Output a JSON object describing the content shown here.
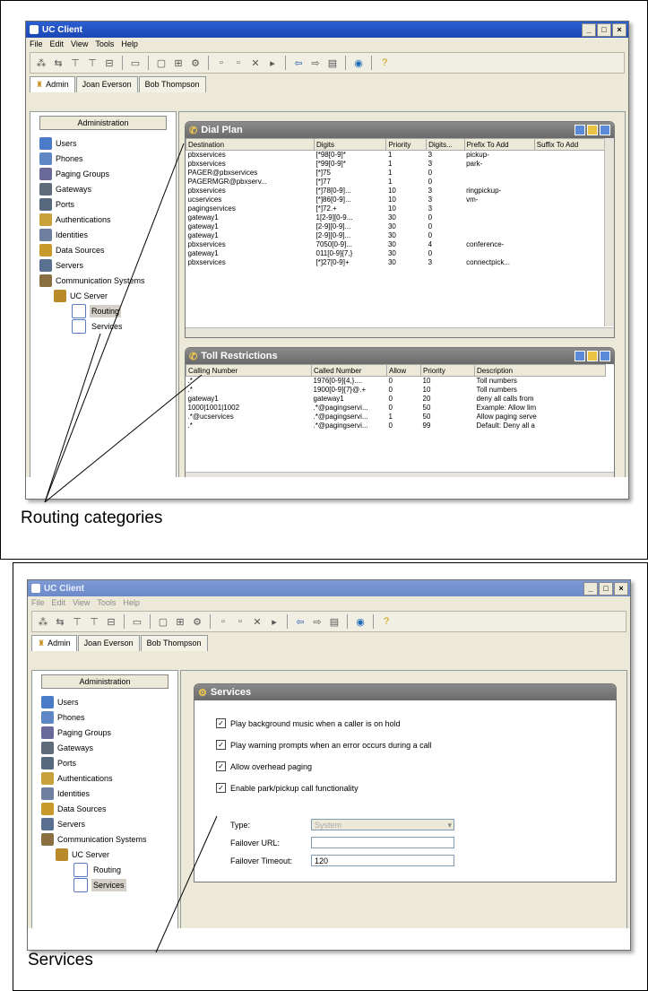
{
  "window": {
    "title": "UC Client",
    "controls": [
      "_",
      "□",
      "×"
    ],
    "menu": [
      "File",
      "Edit",
      "View",
      "Tools",
      "Help"
    ],
    "toolbar_icons": [
      "tool-1-icon",
      "tool-2-icon",
      "tool-3-icon",
      "tool-4-icon",
      "tool-5-icon",
      "tool-6-icon",
      "tool-7-icon",
      "tool-8-icon",
      "tool-9-icon",
      "tool-10-icon",
      "tool-11-icon",
      "tool-12-icon",
      "tool-13-icon",
      "back-arrow-icon",
      "forward-arrow-icon",
      "page-icon",
      "globe-icon",
      "help-icon"
    ],
    "tabs": [
      "Admin",
      "Joan Everson",
      "Bob Thompson"
    ]
  },
  "sidebar": {
    "header": "Administration",
    "items": [
      {
        "label": "Users",
        "icon": "users-icon",
        "color": "#4a7bc8"
      },
      {
        "label": "Phones",
        "icon": "phones-icon",
        "color": "#5d88c5"
      },
      {
        "label": "Paging Groups",
        "icon": "paging-groups-icon",
        "color": "#6a6a9a"
      },
      {
        "label": "Gateways",
        "icon": "gateways-icon",
        "color": "#5e6b7a"
      },
      {
        "label": "Ports",
        "icon": "ports-icon",
        "color": "#56697f"
      },
      {
        "label": "Authentications",
        "icon": "authentications-icon",
        "color": "#c8a13a"
      },
      {
        "label": "Identities",
        "icon": "identities-icon",
        "color": "#6f7fa0"
      },
      {
        "label": "Data Sources",
        "icon": "data-sources-icon",
        "color": "#c89a2c"
      },
      {
        "label": "Servers",
        "icon": "servers-icon",
        "color": "#5a7090"
      },
      {
        "label": "Communication Systems",
        "icon": "communication-systems-icon",
        "color": "#8a7040"
      }
    ],
    "server": "UC Server",
    "children": [
      "Routing",
      "Services"
    ]
  },
  "dial_plan": {
    "title": "Dial Plan",
    "columns": [
      "Destination",
      "Digits",
      "Priority",
      "Digits...",
      "Prefix To Add",
      "Suffix To Add"
    ],
    "rows": [
      [
        "pbxservices",
        "[*98[0-9]*",
        "1",
        "3",
        "pickup-",
        ""
      ],
      [
        "pbxservices",
        "[*99[0-9]*",
        "1",
        "3",
        "park-",
        ""
      ],
      [
        "PAGER@pbxservices",
        "[*]75",
        "1",
        "0",
        "",
        ""
      ],
      [
        "PAGERMGR@pbxserv...",
        "[*]77",
        "1",
        "0",
        "",
        ""
      ],
      [
        "pbxservices",
        "[*]78[0-9]...",
        "10",
        "3",
        "ringpickup-",
        ""
      ],
      [
        "ucservices",
        "[*]86[0-9]...",
        "10",
        "3",
        "vm-",
        ""
      ],
      [
        "pagingservices",
        "[*]72.+",
        "10",
        "3",
        "",
        ""
      ],
      [
        "gateway1",
        "1[2-9][0-9...",
        "30",
        "0",
        "",
        ""
      ],
      [
        "gateway1",
        "[2-9][0-9]...",
        "30",
        "0",
        "",
        ""
      ],
      [
        "gateway1",
        "[2-9][0-9]...",
        "30",
        "0",
        "",
        ""
      ],
      [
        "pbxservices",
        "7050[0-9]...",
        "30",
        "4",
        "conference-",
        ""
      ],
      [
        "gateway1",
        "011[0-9]{7,}",
        "30",
        "0",
        "",
        ""
      ],
      [
        "pbxservices",
        "[*]27[0-9]+",
        "30",
        "3",
        "connectpick...",
        ""
      ]
    ]
  },
  "toll_restrictions": {
    "title": "Toll Restrictions",
    "columns": [
      "Calling Number",
      "Called Number",
      "Allow",
      "Priority",
      "Description"
    ],
    "rows": [
      [
        ".*",
        "1976[0-9]{4,}....",
        "0",
        "10",
        "Toll numbers"
      ],
      [
        ".*",
        "1900[0-9]{7}@.+",
        "0",
        "10",
        "Toll numbers"
      ],
      [
        "gateway1",
        "gateway1",
        "0",
        "20",
        "deny all calls from"
      ],
      [
        "1000|1001|1002",
        ".*@pagingservi...",
        "0",
        "50",
        "Example: Allow lim"
      ],
      [
        ".*@ucservices",
        ".*@pagingservi...",
        "1",
        "50",
        "Allow paging serve"
      ],
      [
        ".*",
        ".*@pagingservi...",
        "0",
        "99",
        "Default: Deny all a"
      ]
    ]
  },
  "captions": {
    "top": "Routing categories",
    "bottom": "Services"
  },
  "services": {
    "title": "Services",
    "checks": [
      "Play background music when a caller is on hold",
      "Play warning prompts when an error occurs during a call",
      "Allow overhead paging",
      "Enable park/pickup call functionality"
    ],
    "type_label": "Type:",
    "type_value": "System",
    "failover_url_label": "Failover URL:",
    "failover_url_value": "",
    "failover_timeout_label": "Failover Timeout:",
    "failover_timeout_value": "120"
  }
}
